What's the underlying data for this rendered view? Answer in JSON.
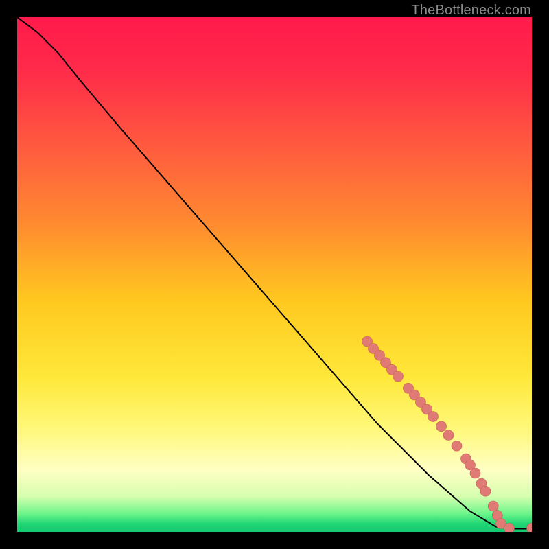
{
  "attribution": "TheBottleneck.com",
  "colors": {
    "gradient_stops": [
      {
        "offset": 0.0,
        "color": "#ff1a4b"
      },
      {
        "offset": 0.1,
        "color": "#ff2a4a"
      },
      {
        "offset": 0.25,
        "color": "#ff5a3f"
      },
      {
        "offset": 0.4,
        "color": "#ff8a30"
      },
      {
        "offset": 0.55,
        "color": "#ffc81f"
      },
      {
        "offset": 0.7,
        "color": "#ffe83a"
      },
      {
        "offset": 0.8,
        "color": "#fff87a"
      },
      {
        "offset": 0.88,
        "color": "#ffffc4"
      },
      {
        "offset": 0.93,
        "color": "#d8ffb0"
      },
      {
        "offset": 0.965,
        "color": "#6cf58a"
      },
      {
        "offset": 0.985,
        "color": "#1fd574"
      },
      {
        "offset": 1.0,
        "color": "#14c96f"
      }
    ],
    "line": "#000000",
    "dot_fill": "#e07a74",
    "dot_stroke": "#c25a55"
  },
  "chart_data": {
    "type": "line",
    "title": "",
    "xlabel": "",
    "ylabel": "",
    "xlim": [
      0,
      100
    ],
    "ylim": [
      0,
      100
    ],
    "grid": false,
    "line_points": [
      {
        "x": 0,
        "y": 100
      },
      {
        "x": 4,
        "y": 97
      },
      {
        "x": 8,
        "y": 93
      },
      {
        "x": 12,
        "y": 88
      },
      {
        "x": 20,
        "y": 78.5
      },
      {
        "x": 30,
        "y": 67
      },
      {
        "x": 40,
        "y": 55.5
      },
      {
        "x": 50,
        "y": 44
      },
      {
        "x": 60,
        "y": 32.5
      },
      {
        "x": 70,
        "y": 21
      },
      {
        "x": 80,
        "y": 11
      },
      {
        "x": 88,
        "y": 4
      },
      {
        "x": 93,
        "y": 1
      },
      {
        "x": 96,
        "y": 0.6
      },
      {
        "x": 100,
        "y": 0.6
      }
    ],
    "dots": [
      {
        "x": 68.0,
        "y": 37.0
      },
      {
        "x": 69.2,
        "y": 35.6
      },
      {
        "x": 70.4,
        "y": 34.3
      },
      {
        "x": 71.6,
        "y": 32.9
      },
      {
        "x": 72.8,
        "y": 31.5
      },
      {
        "x": 74.0,
        "y": 30.2
      },
      {
        "x": 76.0,
        "y": 27.9
      },
      {
        "x": 77.2,
        "y": 26.6
      },
      {
        "x": 78.4,
        "y": 25.2
      },
      {
        "x": 79.6,
        "y": 23.8
      },
      {
        "x": 80.8,
        "y": 22.4
      },
      {
        "x": 82.4,
        "y": 20.5
      },
      {
        "x": 83.8,
        "y": 18.8
      },
      {
        "x": 85.4,
        "y": 16.7
      },
      {
        "x": 87.2,
        "y": 14.2
      },
      {
        "x": 88.0,
        "y": 13.0
      },
      {
        "x": 89.0,
        "y": 11.4
      },
      {
        "x": 90.2,
        "y": 9.4
      },
      {
        "x": 91.0,
        "y": 7.9
      },
      {
        "x": 92.5,
        "y": 5.0
      },
      {
        "x": 93.3,
        "y": 3.2
      },
      {
        "x": 94.0,
        "y": 1.6
      },
      {
        "x": 95.6,
        "y": 0.7
      },
      {
        "x": 100.0,
        "y": 0.7
      }
    ],
    "dot_radius": 1.0
  }
}
